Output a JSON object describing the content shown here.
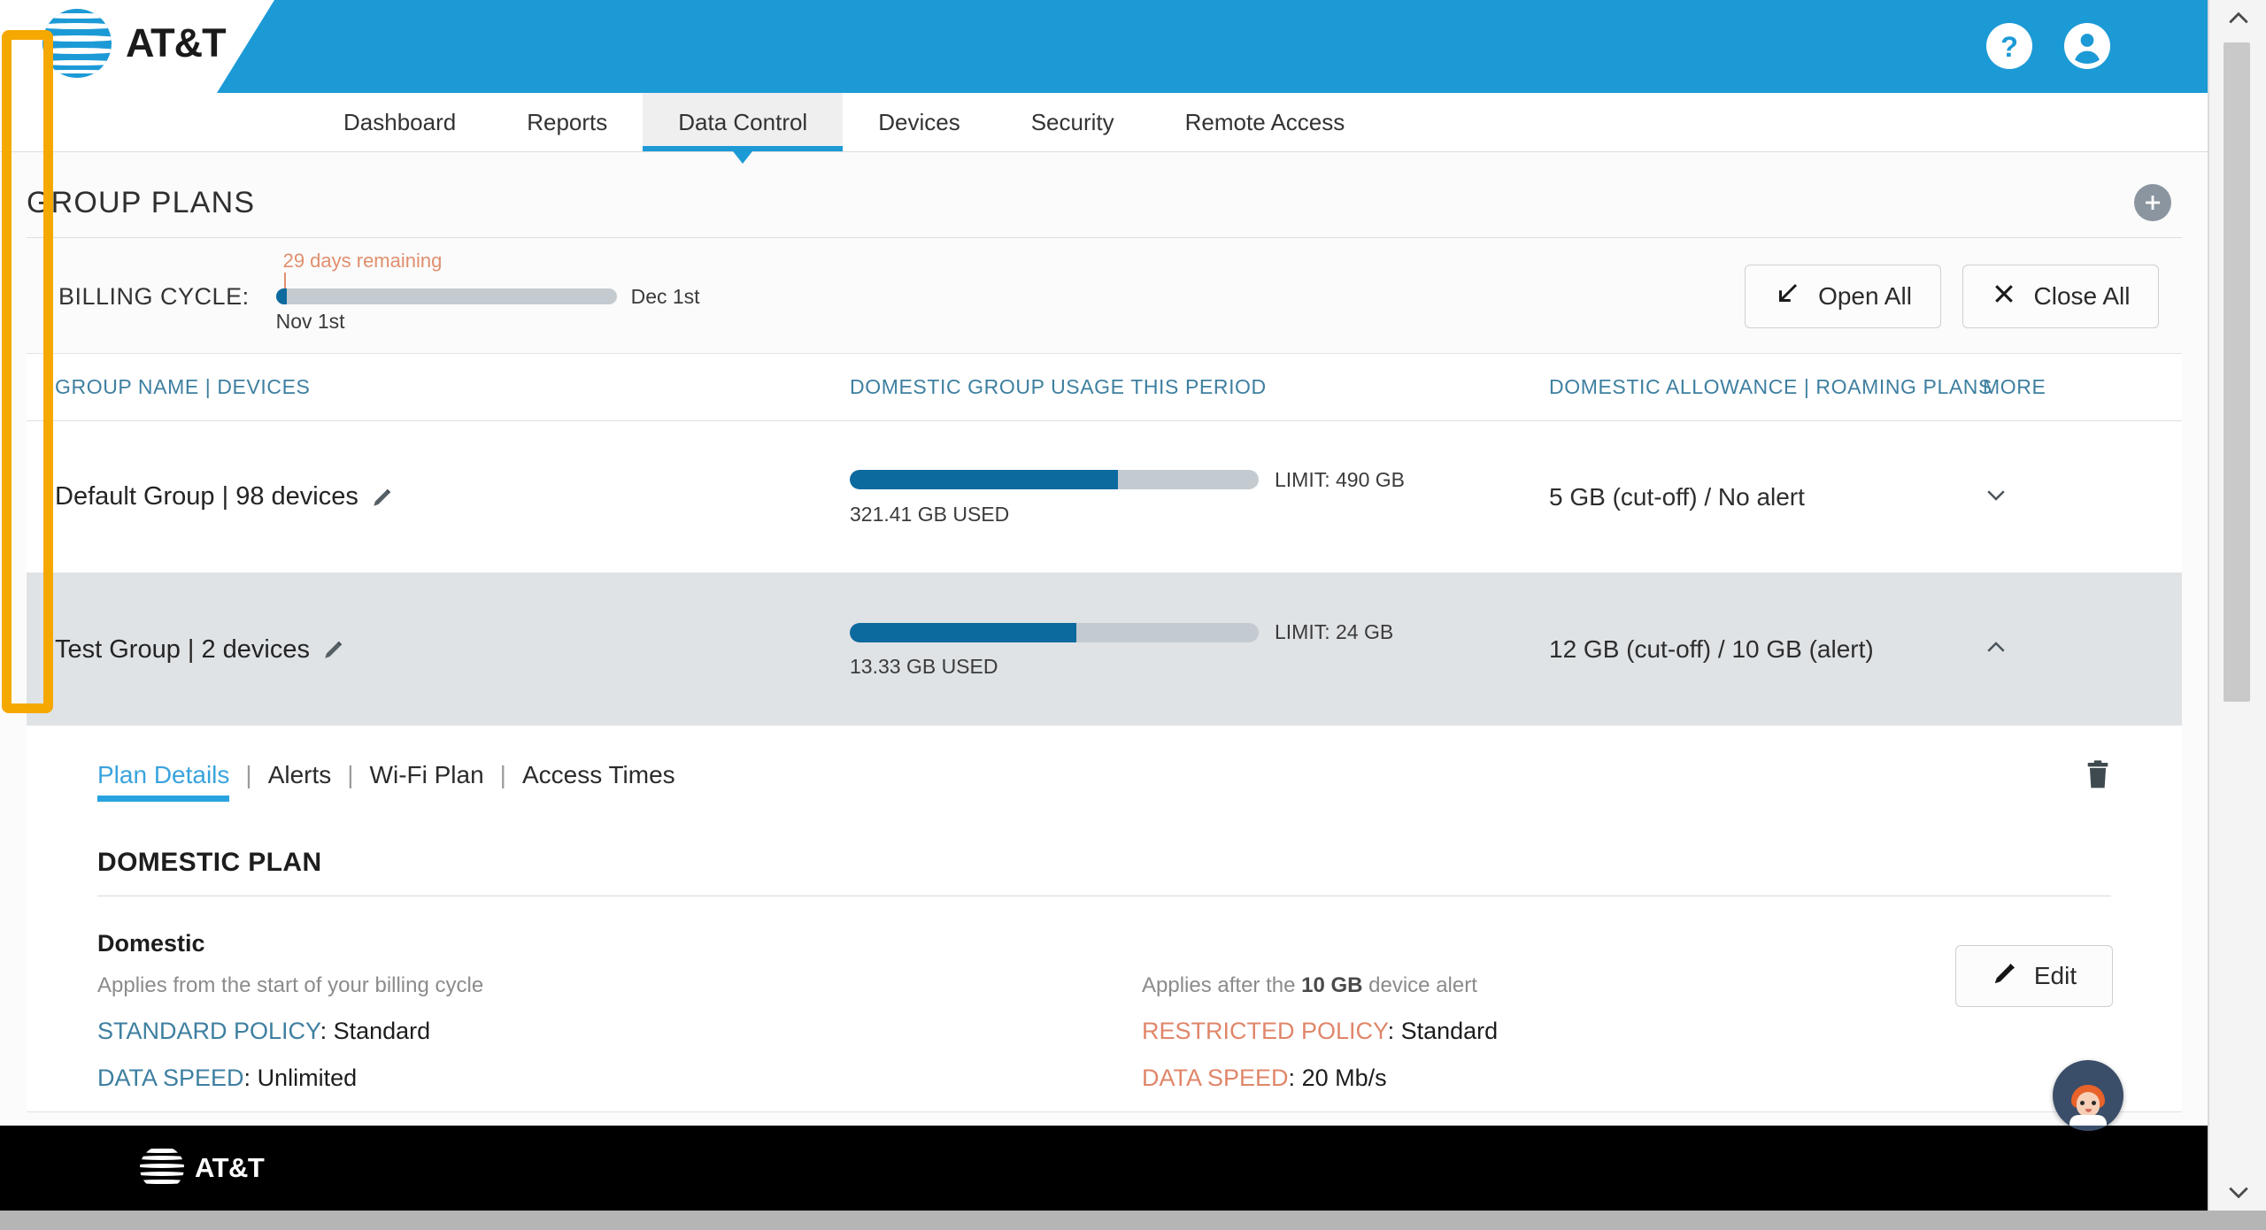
{
  "brand": {
    "name": "AT&T",
    "header_color": "#1c9ad6",
    "accent_color": "#29a3e0"
  },
  "header": {
    "help_icon": "help-circle-icon",
    "account_icon": "account-circle-icon"
  },
  "nav": {
    "items": [
      {
        "label": "Dashboard",
        "active": false
      },
      {
        "label": "Reports",
        "active": false
      },
      {
        "label": "Data Control",
        "active": true
      },
      {
        "label": "Devices",
        "active": false
      },
      {
        "label": "Security",
        "active": false
      },
      {
        "label": "Remote Access",
        "active": false
      }
    ]
  },
  "page": {
    "title": "GROUP PLANS",
    "add_button_label": "+"
  },
  "billing": {
    "label": "BILLING CYCLE:",
    "days_remaining": "29 days remaining",
    "start": "Nov 1st",
    "end": "Dec 1st",
    "progress_percent": 3,
    "open_all": "Open All",
    "close_all": "Close All"
  },
  "table": {
    "headers": {
      "name": "GROUP NAME | DEVICES",
      "usage": "DOMESTIC GROUP USAGE THIS PERIOD",
      "allowance": "DOMESTIC ALLOWANCE | ROAMING PLANS",
      "more": "MORE"
    },
    "rows": [
      {
        "name": "Default Group | 98 devices",
        "used_label": "321.41 GB USED",
        "limit_label": "LIMIT: 490 GB",
        "used_gb": 321.41,
        "limit_gb": 490,
        "fill_percent": 65.6,
        "allowance": "5 GB (cut-off) / No alert",
        "expanded": false,
        "chevron": "chevron-down-icon"
      },
      {
        "name": "Test Group | 2 devices",
        "used_label": "13.33 GB USED",
        "limit_label": "LIMIT: 24 GB",
        "used_gb": 13.33,
        "limit_gb": 24,
        "fill_percent": 55.5,
        "allowance": "12 GB (cut-off) / 10 GB (alert)",
        "expanded": true,
        "chevron": "chevron-up-icon"
      }
    ]
  },
  "panel": {
    "subtabs": [
      {
        "label": "Plan Details",
        "active": true
      },
      {
        "label": "Alerts",
        "active": false
      },
      {
        "label": "Wi-Fi Plan",
        "active": false
      },
      {
        "label": "Access Times",
        "active": false
      }
    ],
    "separator": "|",
    "delete_icon": "trash-icon",
    "section_title": "DOMESTIC PLAN",
    "edit_label": "Edit",
    "left": {
      "heading": "Domestic",
      "note": "Applies from the start of your billing cycle",
      "policy_key": "STANDARD POLICY",
      "policy_value": "Standard",
      "speed_key": "DATA SPEED",
      "speed_value": "Unlimited"
    },
    "right": {
      "note_prefix": "Applies after the ",
      "note_bold": "10 GB",
      "note_suffix": " device alert",
      "policy_key": "RESTRICTED POLICY",
      "policy_value": "Standard",
      "speed_key": "DATA SPEED",
      "speed_value": "20 Mb/s"
    }
  },
  "footer": {
    "brand": "AT&T"
  },
  "chat": {
    "label": "chat-assistant-avatar"
  },
  "scrollbar": {
    "highlight_color": "#f5a800"
  }
}
